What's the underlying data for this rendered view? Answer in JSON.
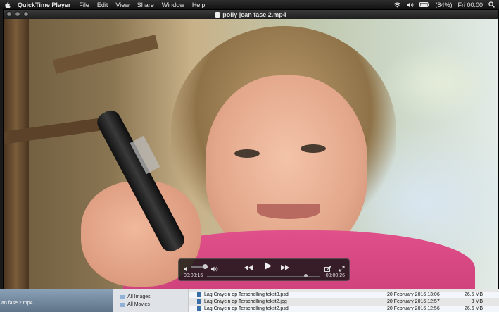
{
  "menubar": {
    "app_name": "QuickTime Player",
    "menus": [
      "File",
      "Edit",
      "View",
      "Share",
      "Window",
      "Help"
    ],
    "battery": "(84%)",
    "clock": "Fri 00:00"
  },
  "window": {
    "title": "polly jean fase 2.mp4"
  },
  "hud": {
    "elapsed": "00:03:16",
    "remaining": "-00:00:26",
    "progress": 0.88,
    "volume": 0.8
  },
  "finder": {
    "left_label": "an fase 2.mp4",
    "sidebar": [
      {
        "label": "All Images"
      },
      {
        "label": "All Movies"
      }
    ],
    "files": [
      {
        "name": "Lag Craycin op Terschelling tekst3.psd",
        "date": "20 February 2016 13:06",
        "size": "26.5 MB"
      },
      {
        "name": "Lag Craycin op Terschelling tekst2.jpg",
        "date": "20 February 2016 12:57",
        "size": "3 MB"
      },
      {
        "name": "Lag Craycin op Terschelling tekst2.psd",
        "date": "20 February 2016 12:56",
        "size": "26.6 MB"
      }
    ]
  },
  "colors": {
    "menubar_bg": "#1a1a1a",
    "hud_bg": "#141414",
    "sweater": "#d94683"
  }
}
